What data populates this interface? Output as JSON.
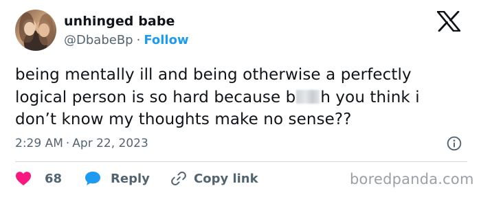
{
  "author": {
    "display_name": "unhinged babe",
    "handle": "@DbabeBp",
    "separator": "·",
    "follow_label": "Follow",
    "avatar_icon": "avatar-photo"
  },
  "platform_icon": "x-logo-icon",
  "tweet": {
    "line1": "being mentally ill and being otherwise a perfectly",
    "line2_before": "logical person is so hard because b",
    "line2_after": "h you think i",
    "line3": "don’t know my thoughts make no sense??"
  },
  "meta": {
    "time": "2:29 AM",
    "separator": "·",
    "date": "Apr 22, 2023",
    "info_icon": "info-icon"
  },
  "actions": {
    "likes_count": "68",
    "reply_label": "Reply",
    "copy_link_label": "Copy link",
    "like_icon": "heart-icon",
    "reply_icon": "reply-bubble-icon",
    "copy_link_icon": "link-icon"
  },
  "watermark": "boredpanda.com",
  "colors": {
    "accent": "#1d9bf0",
    "like": "#f91880",
    "muted": "#536471",
    "text": "#0f1419"
  }
}
